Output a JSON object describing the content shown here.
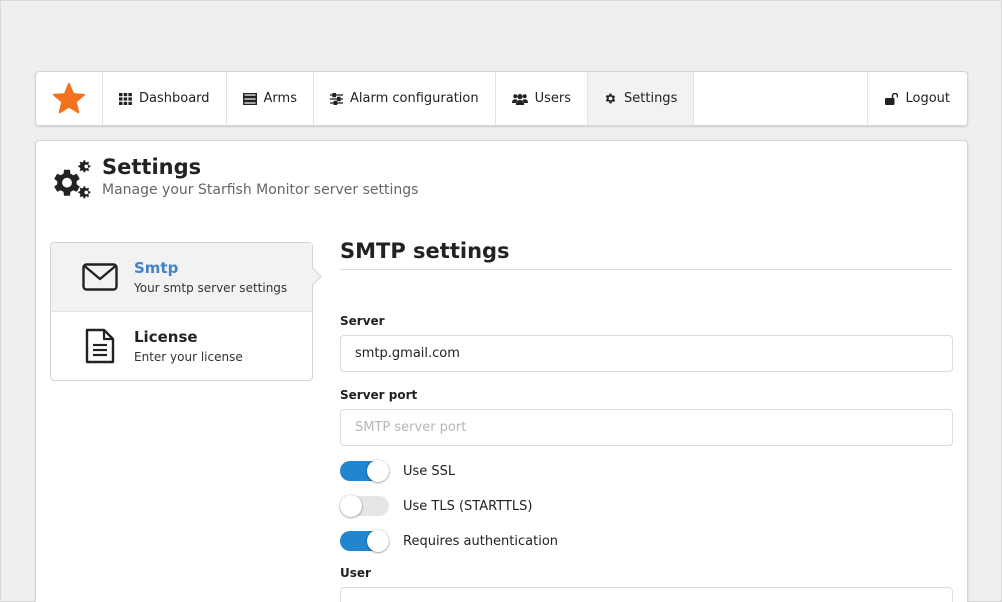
{
  "colors": {
    "accent": "#2185d0",
    "link": "#4183c4",
    "logo_star": "#f2711c"
  },
  "nav": {
    "logo_icon": "star-icon",
    "items": [
      {
        "label": "Dashboard",
        "icon": "grid-icon"
      },
      {
        "label": "Arms",
        "icon": "list-icon"
      },
      {
        "label": "Alarm configuration",
        "icon": "sliders-icon"
      },
      {
        "label": "Users",
        "icon": "users-icon"
      },
      {
        "label": "Settings",
        "icon": "gear-icon",
        "active": true
      }
    ],
    "logout": {
      "label": "Logout",
      "icon": "unlock-icon"
    }
  },
  "header": {
    "title": "Settings",
    "subtitle": "Manage your Starfish Monitor server settings",
    "icon": "gears-icon"
  },
  "menu": {
    "items": [
      {
        "title": "Smtp",
        "description": "Your smtp server settings",
        "icon": "envelope-icon",
        "active": true
      },
      {
        "title": "License",
        "description": "Enter your license",
        "icon": "file-text-icon"
      }
    ]
  },
  "smtp": {
    "heading": "SMTP settings",
    "server": {
      "label": "Server",
      "value": "smtp.gmail.com",
      "placeholder": ""
    },
    "port": {
      "label": "Server port",
      "value": "",
      "placeholder": "SMTP server port"
    },
    "toggles": [
      {
        "label": "Use SSL",
        "checked": true
      },
      {
        "label": "Use TLS (STARTTLS)",
        "checked": false
      },
      {
        "label": "Requires authentication",
        "checked": true
      }
    ],
    "user": {
      "label": "User",
      "value": "",
      "placeholder": ""
    }
  }
}
